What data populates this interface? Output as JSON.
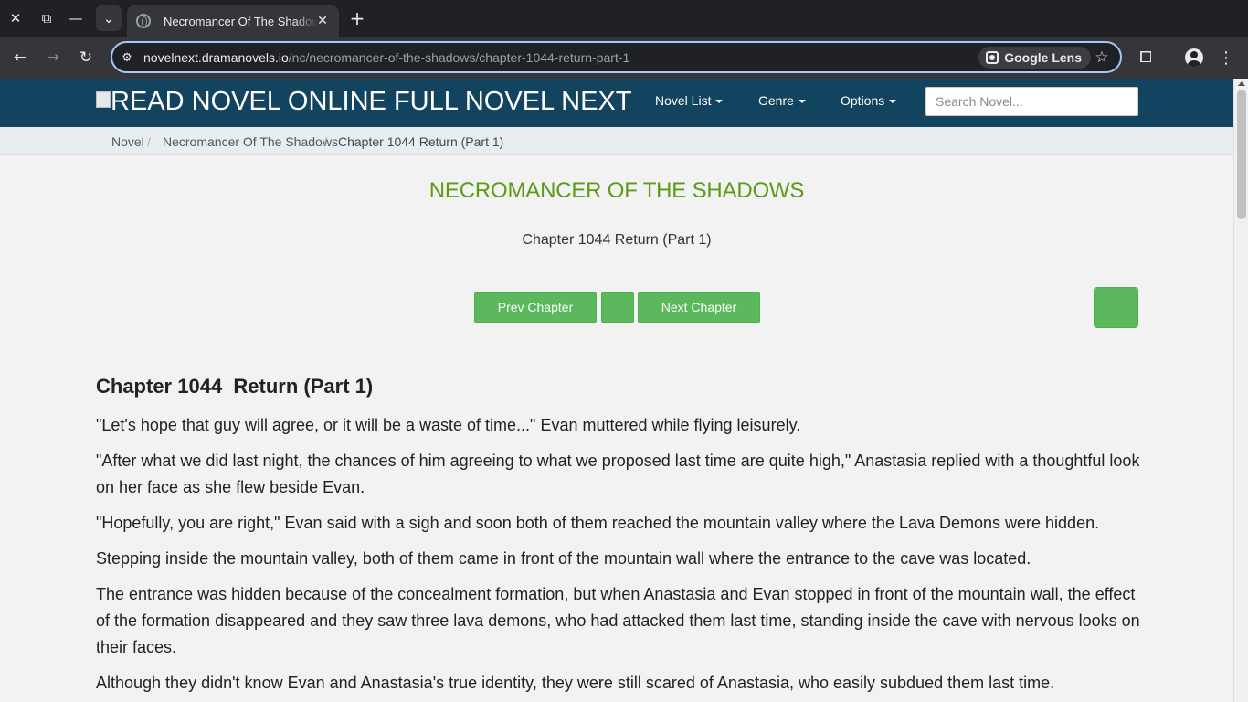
{
  "browser": {
    "tab_title": "Necromancer Of The Shadows",
    "url_host": "novelnext.dramanovels.io",
    "url_path": "/nc/necromancer-of-the-shadows/chapter-1044-return-part-1",
    "lens_label": "Google Lens"
  },
  "site": {
    "brand": "READ NOVEL ONLINE FULL NOVEL NEXT",
    "nav": {
      "novel_list": "Novel List",
      "genre": "Genre",
      "options": "Options"
    },
    "search_placeholder": "Search Novel..."
  },
  "breadcrumb": {
    "items": [
      "Novel",
      "Necromancer Of The Shadows",
      "Chapter 1044 Return (Part 1)"
    ]
  },
  "page": {
    "novel_title": "NECROMANCER OF THE SHADOWS",
    "chapter_subtitle": "Chapter 1044 Return (Part 1)",
    "prev_label": "Prev Chapter",
    "next_label": "Next Chapter",
    "buttons_color": "#5cb85c"
  },
  "chapter": {
    "heading": "Chapter 1044  Return (Part 1)",
    "paragraphs": [
      "\"Let's hope that guy will agree, or it will be a waste of time...\" Evan muttered while flying leisurely.",
      "\"After what we did last night, the chances of him agreeing to what we proposed last time are quite high,\" Anastasia replied with a thoughtful look on her face as she flew beside Evan.",
      "\"Hopefully, you are right,\" Evan said with a sigh and soon both of them reached the mountain valley where the Lava Demons were hidden.",
      "Stepping inside the mountain valley, both of them came in front of the mountain wall where the entrance to the cave was located.",
      "The entrance was hidden because of the concealment formation, but when Anastasia and Evan stopped in front of the mountain wall, the effect of the formation disappeared and they saw three lava demons, who had attacked them last time, standing inside the cave with nervous looks on their faces.",
      "Although they didn't know Evan and Anastasia's true identity, they were still scared of Anastasia, who easily subdued them last time."
    ]
  }
}
